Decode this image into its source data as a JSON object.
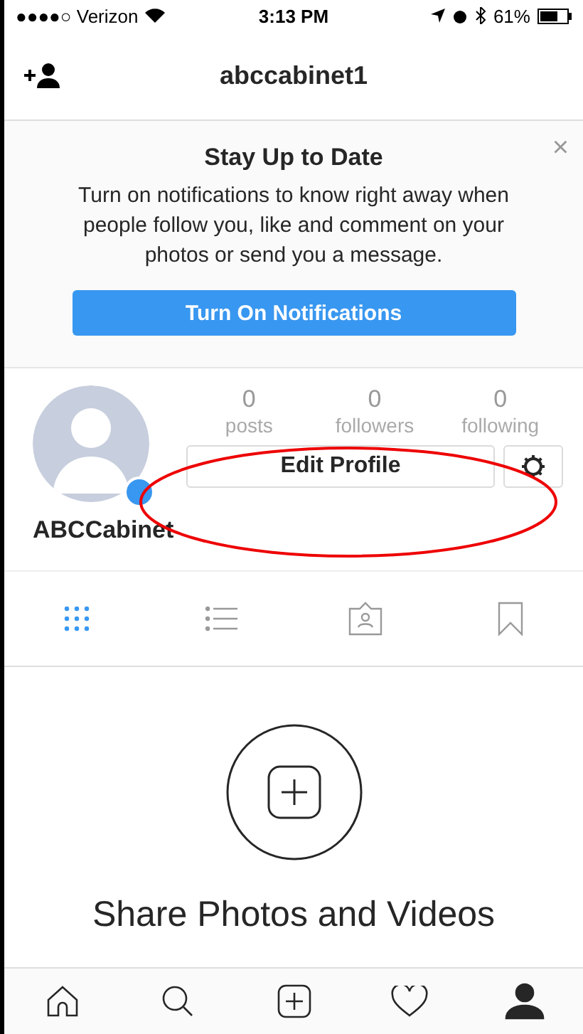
{
  "status_bar": {
    "carrier": "●●●●○ Verizon",
    "time": "3:13 PM",
    "battery": "61%"
  },
  "nav": {
    "title": "abccabinet1"
  },
  "banner": {
    "title": "Stay Up to Date",
    "message": "Turn on notifications to know right away when people follow you, like and comment on your photos or send you a message.",
    "button": "Turn On Notifications",
    "close": "×"
  },
  "profile": {
    "name": "ABCCabinet",
    "stats": [
      {
        "value": "0",
        "label": "posts"
      },
      {
        "value": "0",
        "label": "followers"
      },
      {
        "value": "0",
        "label": "following"
      }
    ],
    "edit_button": "Edit Profile"
  },
  "tabs": [
    {
      "kind": "grid",
      "selected": true
    },
    {
      "kind": "list",
      "selected": false
    },
    {
      "kind": "tagged",
      "selected": false
    },
    {
      "kind": "saved",
      "selected": false
    }
  ],
  "empty_state": {
    "title": "Share Photos and Videos"
  },
  "bottom_nav": [
    {
      "kind": "home",
      "selected": false
    },
    {
      "kind": "search",
      "selected": false
    },
    {
      "kind": "add",
      "selected": false
    },
    {
      "kind": "activity",
      "selected": false
    },
    {
      "kind": "profile",
      "selected": true
    }
  ]
}
